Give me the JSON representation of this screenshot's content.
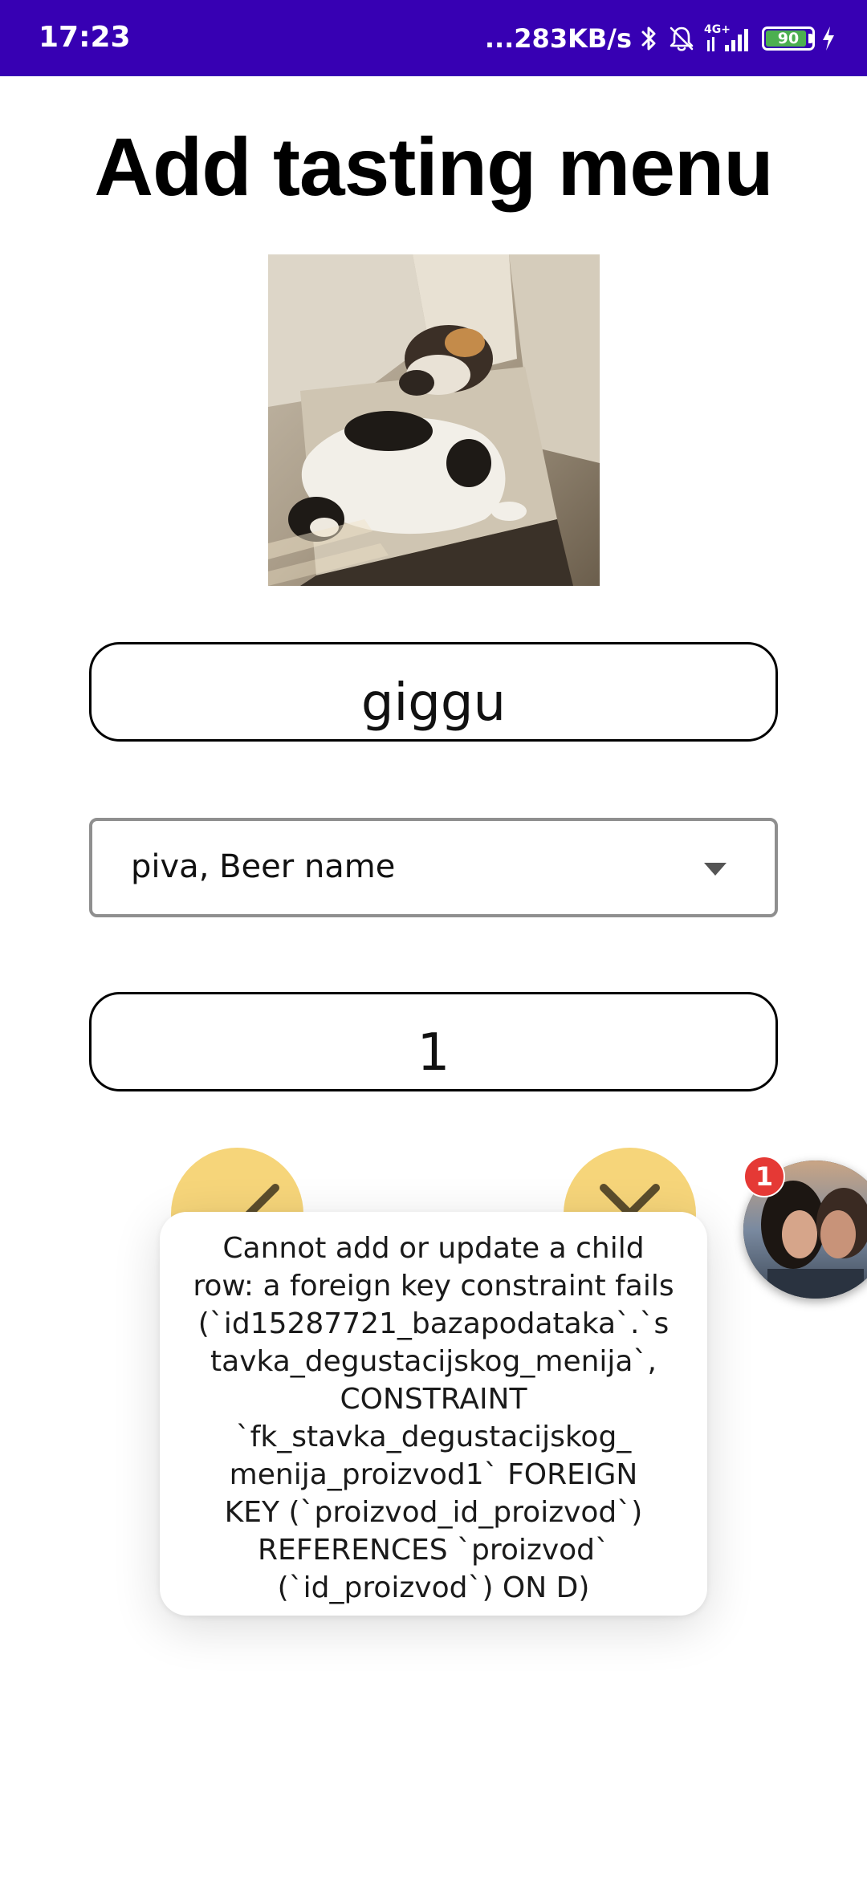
{
  "status_bar": {
    "time": "17:23",
    "net_speed": "...283KB/s",
    "network_type": "4G+",
    "battery_level": "90",
    "icons": [
      "bluetooth-icon",
      "mute-icon",
      "signal-icon",
      "battery-icon",
      "charging-icon"
    ],
    "bg_color": "#3700b3"
  },
  "page": {
    "title": "Add tasting menu"
  },
  "photo": {
    "description_icon": "cats-photo"
  },
  "form": {
    "name_value": "giggu",
    "spinner_value": "piva, Beer name",
    "quantity_value": "1"
  },
  "buttons": {
    "confirm_icon": "check-icon",
    "cancel_icon": "close-icon",
    "color": "#f6d57a"
  },
  "toast": {
    "lines": [
      "Cannot add or update a child",
      "row: a foreign key constraint fails",
      "(`id15287721_bazapodataka`.`s",
      "tavka_degustacijskog_menija`,",
      "CONSTRAINT",
      "`fk_stavka_degustacijskog_",
      "menija_proizvod1` FOREIGN",
      "KEY (`proizvod_id_proizvod`)",
      "REFERENCES `proizvod`",
      "(`id_proizvod`) ON D)"
    ]
  },
  "chat_head": {
    "badge_count": "1"
  }
}
